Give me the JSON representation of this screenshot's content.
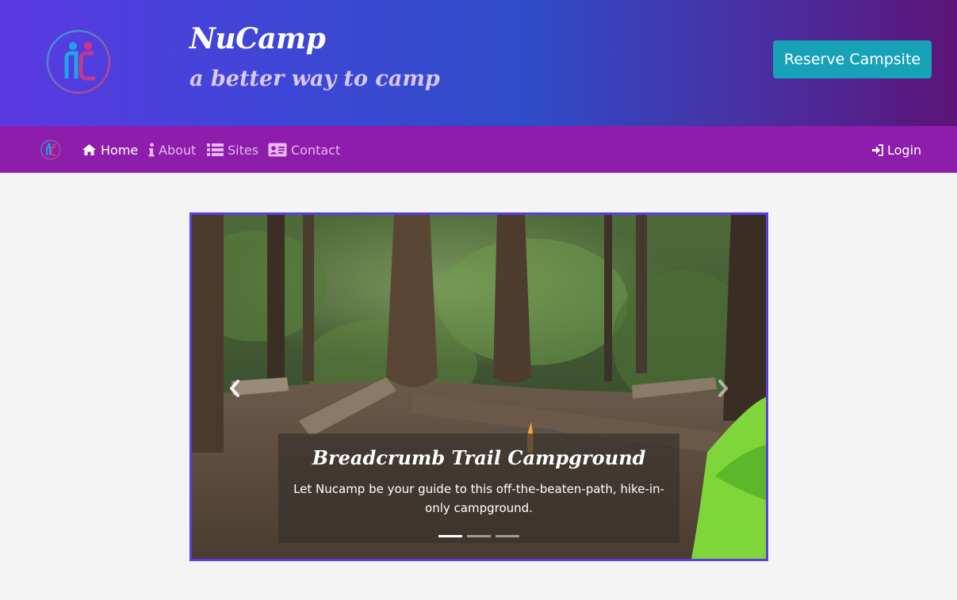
{
  "header": {
    "brand_title": "NuCamp",
    "brand_subtitle": "a better way to camp",
    "reserve_label": "Reserve Campsite",
    "colors": {
      "gradient_start": "#5b39e3",
      "gradient_end": "#5c1478",
      "button": "#17a2b8"
    }
  },
  "nav": {
    "items": [
      {
        "label": "Home",
        "icon": "home-icon",
        "active": true
      },
      {
        "label": "About",
        "icon": "info-icon",
        "active": false
      },
      {
        "label": "Sites",
        "icon": "list-icon",
        "active": false
      },
      {
        "label": "Contact",
        "icon": "address-card-icon",
        "active": false
      }
    ],
    "login_label": "Login",
    "login_icon": "sign-in-icon",
    "color": "#8e1dac"
  },
  "carousel": {
    "caption_title": "Breadcrumb Trail Campground",
    "caption_text": "Let Nucamp be your guide to this off-the-beaten-path, hike-in-only campground.",
    "slide_count": 3,
    "active_slide": 1,
    "prev_icon": "chevron-left-icon",
    "next_icon": "chevron-right-icon"
  }
}
